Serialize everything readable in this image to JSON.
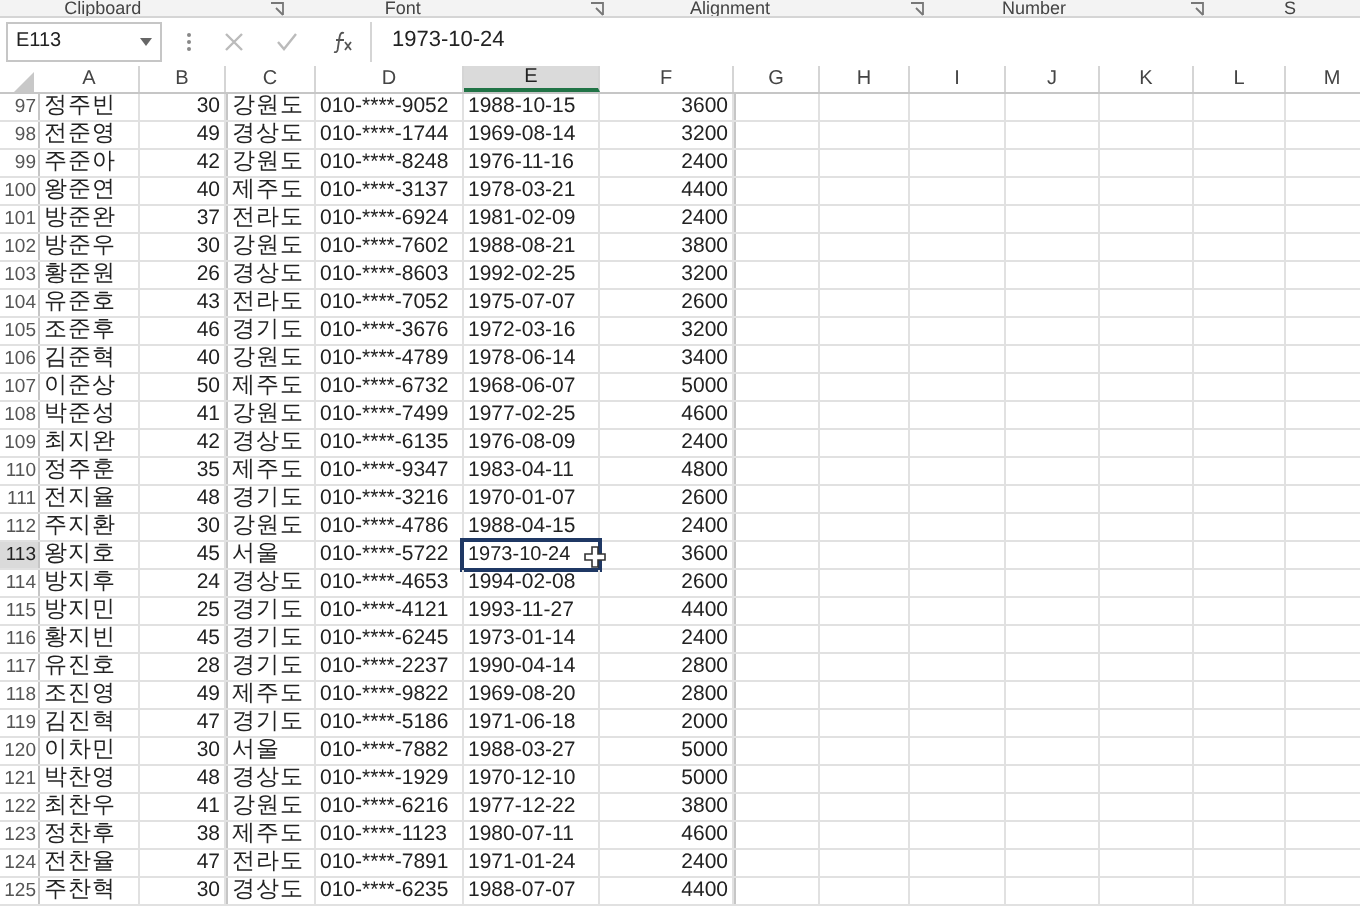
{
  "ribbon_groups": [
    {
      "label": "Clipboard",
      "launcher": true
    },
    {
      "label": "Font",
      "launcher": true
    },
    {
      "label": "Alignment",
      "launcher": true
    },
    {
      "label": "Number",
      "launcher": true
    },
    {
      "label": "S",
      "launcher": false
    }
  ],
  "formula_bar": {
    "name_box": "E113",
    "formula": "1973-10-24"
  },
  "columns": [
    {
      "label": "A",
      "selected": false
    },
    {
      "label": "B",
      "selected": false
    },
    {
      "label": "C",
      "selected": false
    },
    {
      "label": "D",
      "selected": false
    },
    {
      "label": "E",
      "selected": true
    },
    {
      "label": "F",
      "selected": false
    },
    {
      "label": "G",
      "selected": false
    },
    {
      "label": "H",
      "selected": false
    },
    {
      "label": "I",
      "selected": false
    },
    {
      "label": "J",
      "selected": false
    },
    {
      "label": "K",
      "selected": false
    },
    {
      "label": "L",
      "selected": false
    },
    {
      "label": "M",
      "selected": false
    }
  ],
  "rows": [
    {
      "number": "97",
      "selected": false,
      "cells": [
        "정주빈",
        "30",
        "강원도",
        "010-****-9052",
        "1988-10-15",
        "3600"
      ]
    },
    {
      "number": "98",
      "selected": false,
      "cells": [
        "전준영",
        "49",
        "경상도",
        "010-****-1744",
        "1969-08-14",
        "3200"
      ]
    },
    {
      "number": "99",
      "selected": false,
      "cells": [
        "주준아",
        "42",
        "강원도",
        "010-****-8248",
        "1976-11-16",
        "2400"
      ]
    },
    {
      "number": "100",
      "selected": false,
      "cells": [
        "왕준연",
        "40",
        "제주도",
        "010-****-3137",
        "1978-03-21",
        "4400"
      ]
    },
    {
      "number": "101",
      "selected": false,
      "cells": [
        "방준완",
        "37",
        "전라도",
        "010-****-6924",
        "1981-02-09",
        "2400"
      ]
    },
    {
      "number": "102",
      "selected": false,
      "cells": [
        "방준우",
        "30",
        "강원도",
        "010-****-7602",
        "1988-08-21",
        "3800"
      ]
    },
    {
      "number": "103",
      "selected": false,
      "cells": [
        "황준원",
        "26",
        "경상도",
        "010-****-8603",
        "1992-02-25",
        "3200"
      ]
    },
    {
      "number": "104",
      "selected": false,
      "cells": [
        "유준호",
        "43",
        "전라도",
        "010-****-7052",
        "1975-07-07",
        "2600"
      ]
    },
    {
      "number": "105",
      "selected": false,
      "cells": [
        "조준후",
        "46",
        "경기도",
        "010-****-3676",
        "1972-03-16",
        "3200"
      ]
    },
    {
      "number": "106",
      "selected": false,
      "cells": [
        "김준혁",
        "40",
        "강원도",
        "010-****-4789",
        "1978-06-14",
        "3400"
      ]
    },
    {
      "number": "107",
      "selected": false,
      "cells": [
        "이준상",
        "50",
        "제주도",
        "010-****-6732",
        "1968-06-07",
        "5000"
      ]
    },
    {
      "number": "108",
      "selected": false,
      "cells": [
        "박준성",
        "41",
        "강원도",
        "010-****-7499",
        "1977-02-25",
        "4600"
      ]
    },
    {
      "number": "109",
      "selected": false,
      "cells": [
        "최지완",
        "42",
        "경상도",
        "010-****-6135",
        "1976-08-09",
        "2400"
      ]
    },
    {
      "number": "110",
      "selected": false,
      "cells": [
        "정주훈",
        "35",
        "제주도",
        "010-****-9347",
        "1983-04-11",
        "4800"
      ]
    },
    {
      "number": "111",
      "selected": false,
      "cells": [
        "전지율",
        "48",
        "경기도",
        "010-****-3216",
        "1970-01-07",
        "2600"
      ]
    },
    {
      "number": "112",
      "selected": false,
      "cells": [
        "주지환",
        "30",
        "강원도",
        "010-****-4786",
        "1988-04-15",
        "2400"
      ]
    },
    {
      "number": "113",
      "selected": true,
      "cells": [
        "왕지호",
        "45",
        "서울",
        "010-****-5722",
        "1973-10-24",
        "3600"
      ]
    },
    {
      "number": "114",
      "selected": false,
      "cells": [
        "방지후",
        "24",
        "경상도",
        "010-****-4653",
        "1994-02-08",
        "2600"
      ]
    },
    {
      "number": "115",
      "selected": false,
      "cells": [
        "방지민",
        "25",
        "경기도",
        "010-****-4121",
        "1993-11-27",
        "4400"
      ]
    },
    {
      "number": "116",
      "selected": false,
      "cells": [
        "황지빈",
        "45",
        "경기도",
        "010-****-6245",
        "1973-01-14",
        "2400"
      ]
    },
    {
      "number": "117",
      "selected": false,
      "cells": [
        "유진호",
        "28",
        "경기도",
        "010-****-2237",
        "1990-04-14",
        "2800"
      ]
    },
    {
      "number": "118",
      "selected": false,
      "cells": [
        "조진영",
        "49",
        "제주도",
        "010-****-9822",
        "1969-08-20",
        "2800"
      ]
    },
    {
      "number": "119",
      "selected": false,
      "cells": [
        "김진혁",
        "47",
        "경기도",
        "010-****-5186",
        "1971-06-18",
        "2000"
      ]
    },
    {
      "number": "120",
      "selected": false,
      "cells": [
        "이차민",
        "30",
        "서울",
        "010-****-7882",
        "1988-03-27",
        "5000"
      ]
    },
    {
      "number": "121",
      "selected": false,
      "cells": [
        "박찬영",
        "48",
        "경상도",
        "010-****-1929",
        "1970-12-10",
        "5000"
      ]
    },
    {
      "number": "122",
      "selected": false,
      "cells": [
        "최찬우",
        "41",
        "강원도",
        "010-****-6216",
        "1977-12-22",
        "3800"
      ]
    },
    {
      "number": "123",
      "selected": false,
      "cells": [
        "정찬후",
        "38",
        "제주도",
        "010-****-1123",
        "1980-07-11",
        "4600"
      ]
    },
    {
      "number": "124",
      "selected": false,
      "cells": [
        "전찬율",
        "47",
        "전라도",
        "010-****-7891",
        "1971-01-24",
        "2400"
      ]
    },
    {
      "number": "125",
      "selected": false,
      "cells": [
        "주찬혁",
        "30",
        "경상도",
        "010-****-6235",
        "1988-07-07",
        "4400"
      ]
    }
  ]
}
